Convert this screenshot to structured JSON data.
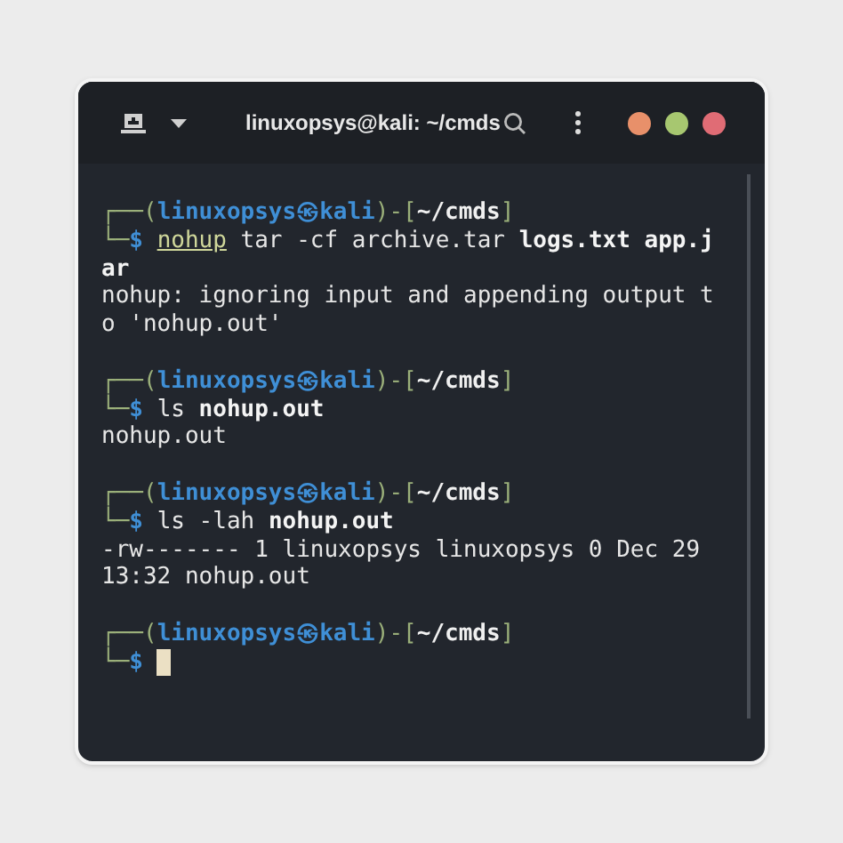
{
  "window": {
    "title": "linuxopsys@kali: ~/cmds"
  },
  "window_controls": [
    {
      "color": "#e8906a"
    },
    {
      "color": "#a7c770"
    },
    {
      "color": "#e06c75"
    }
  ],
  "terminal": {
    "blocks": [
      {
        "prompt": [
          {
            "text": "┌──(",
            "kind": "frame"
          },
          {
            "text": "linuxopsys㉿kali",
            "kind": "user"
          },
          {
            "text": ")-[",
            "kind": "frame"
          },
          {
            "text": "~/cmds",
            "kind": "path"
          },
          {
            "text": "]",
            "kind": "frame"
          }
        ],
        "command_lines": [
          [
            {
              "text": "└─",
              "kind": "frame"
            },
            {
              "text": "$",
              "kind": "dollar"
            },
            {
              "text": "nohup",
              "kind": "cmd"
            },
            {
              "text": "tar -cf archive.tar",
              "kind": "arg"
            },
            {
              "text": "logs.txt app.j",
              "kind": "file"
            }
          ],
          [
            {
              "text": "ar",
              "kind": "file"
            }
          ]
        ],
        "output": [
          "nohup: ignoring input and appending output to 'nohup.out'"
        ]
      },
      {
        "prompt": [
          {
            "text": "┌──(",
            "kind": "frame"
          },
          {
            "text": "linuxopsys㉿kali",
            "kind": "user"
          },
          {
            "text": ")-[",
            "kind": "frame"
          },
          {
            "text": "~/cmds",
            "kind": "path"
          },
          {
            "text": "]",
            "kind": "frame"
          }
        ],
        "command_lines": [
          [
            {
              "text": "└─",
              "kind": "frame"
            },
            {
              "text": "$",
              "kind": "dollar"
            },
            {
              "text": "ls",
              "kind": "arg"
            },
            {
              "text": "nohup.out",
              "kind": "file"
            }
          ]
        ],
        "output": [
          "nohup.out"
        ]
      },
      {
        "prompt": [
          {
            "text": "┌──(",
            "kind": "frame"
          },
          {
            "text": "linuxopsys㉿kali",
            "kind": "user"
          },
          {
            "text": ")-[",
            "kind": "frame"
          },
          {
            "text": "~/cmds",
            "kind": "path"
          },
          {
            "text": "]",
            "kind": "frame"
          }
        ],
        "command_lines": [
          [
            {
              "text": "└─",
              "kind": "frame"
            },
            {
              "text": "$",
              "kind": "dollar"
            },
            {
              "text": "ls -lah",
              "kind": "arg"
            },
            {
              "text": "nohup.out",
              "kind": "file"
            }
          ]
        ],
        "output": [
          "-rw------- 1 linuxopsys linuxopsys 0 Dec 29 13:32 nohup.out"
        ]
      },
      {
        "prompt": [
          {
            "text": "┌──(",
            "kind": "frame"
          },
          {
            "text": "linuxopsys㉿kali",
            "kind": "user"
          },
          {
            "text": ")-[",
            "kind": "frame"
          },
          {
            "text": "~/cmds",
            "kind": "path"
          },
          {
            "text": "]",
            "kind": "frame"
          }
        ],
        "command_lines": [
          [
            {
              "text": "└─",
              "kind": "frame"
            },
            {
              "text": "$",
              "kind": "dollar"
            }
          ]
        ],
        "cursor": true
      }
    ]
  }
}
